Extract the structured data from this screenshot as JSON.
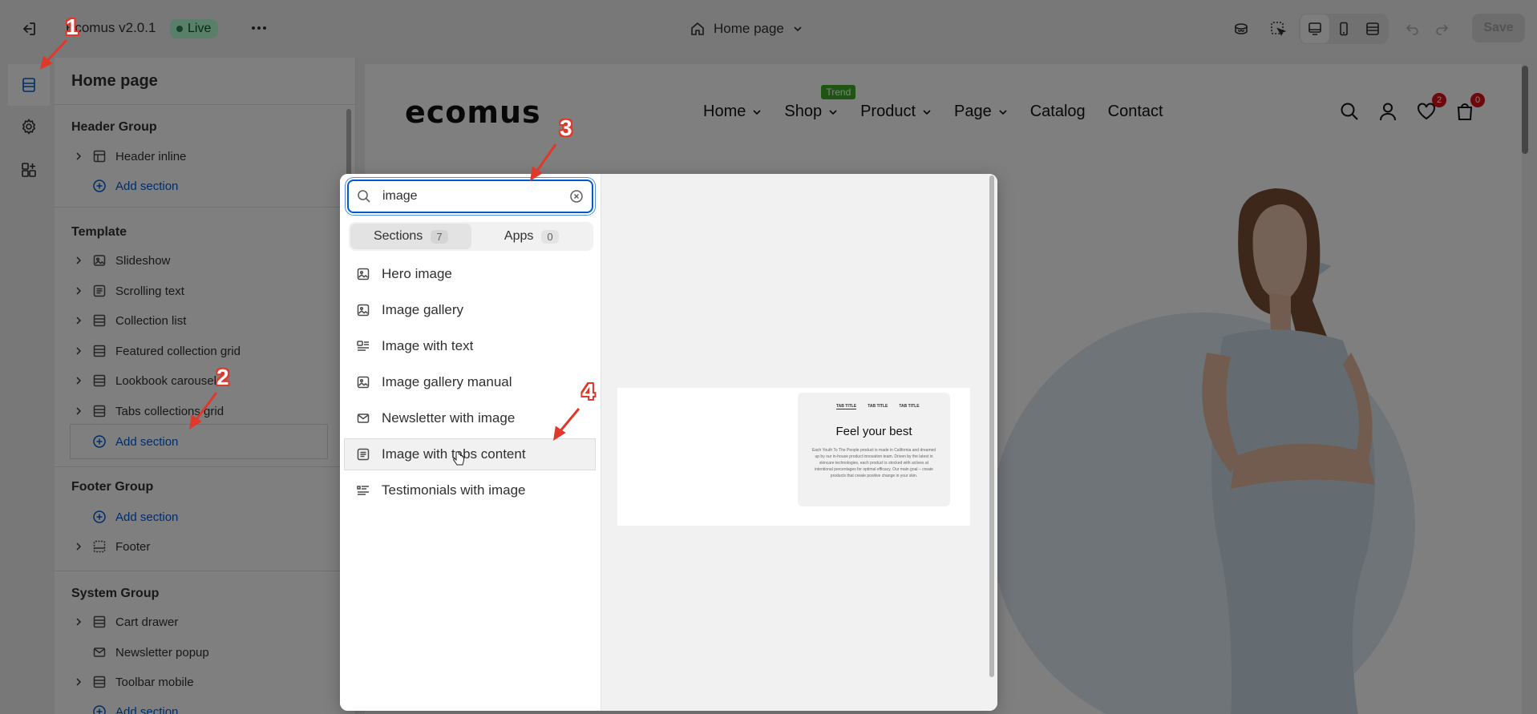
{
  "topbar": {
    "title": "Ecomus v2.0.1",
    "status": "Live",
    "page_selector": "Home page",
    "save_label": "Save"
  },
  "sidebar": {
    "title": "Home page",
    "groups": {
      "header": {
        "title": "Header Group",
        "items": [
          "Header inline"
        ],
        "add_label": "Add section"
      },
      "template": {
        "title": "Template",
        "items": [
          "Slideshow",
          "Scrolling text",
          "Collection list",
          "Featured collection grid",
          "Lookbook carousel",
          "Tabs collections grid"
        ],
        "add_label": "Add section"
      },
      "footer": {
        "title": "Footer Group",
        "add_label": "Add section",
        "items": [
          "Footer"
        ]
      },
      "system": {
        "title": "System Group",
        "items": [
          "Cart drawer",
          "Newsletter popup",
          "Toolbar mobile"
        ],
        "add_label": "Add section"
      }
    }
  },
  "popover": {
    "search_value": "image",
    "tabs": [
      {
        "label": "Sections",
        "count": "7"
      },
      {
        "label": "Apps",
        "count": "0"
      }
    ],
    "items": [
      "Hero image",
      "Image gallery",
      "Image with text",
      "Image gallery manual",
      "Newsletter with image",
      "Image with tabs content",
      "Testimonials with image"
    ],
    "preview": {
      "tabs": [
        "TAB TITLE",
        "TAB TITLE",
        "TAB TITLE"
      ],
      "heading": "Feel your best",
      "body": "Each Youth To The People product is made in California and dreamed up by our in-house product innovation team. Driven by the latest in skincare technologies, each product is stocked with actives at intentional percentages for optimal efficacy. Our main goal – create products that create positive change in your skin."
    }
  },
  "store": {
    "logo": "ecomus",
    "nav": [
      "Home",
      "Shop",
      "Product",
      "Page",
      "Catalog",
      "Contact"
    ],
    "shop_badge": "Trend",
    "wishlist_count": "2",
    "cart_count": "0"
  },
  "annotations": [
    "1",
    "2",
    "3",
    "4"
  ],
  "colors": {
    "accent": "#005bd3",
    "live_bg": "#b4fed2",
    "annotation": "#e0392b",
    "badge_red": "#db1215",
    "trend_green": "#3dab25"
  }
}
